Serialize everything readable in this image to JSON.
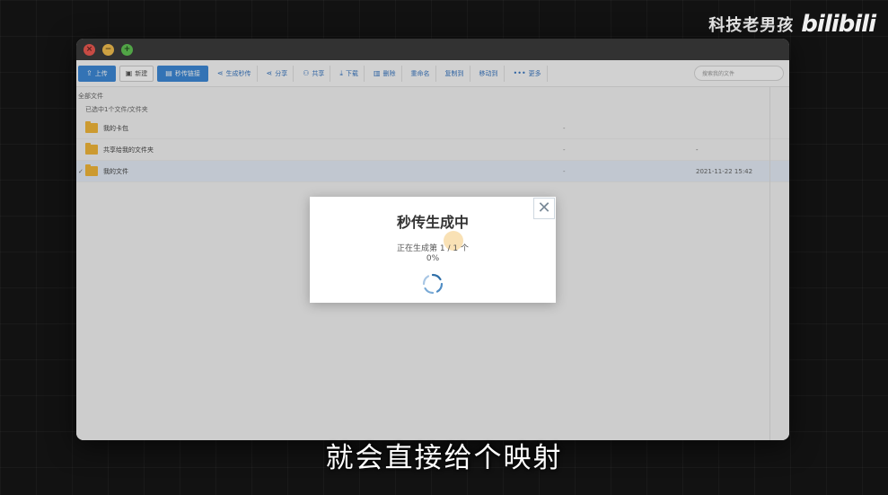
{
  "watermark": {
    "channel": "科技老男孩",
    "logo": "bilibili"
  },
  "window": {
    "controls": {
      "close": "×",
      "minimize": "−",
      "zoom": "+"
    }
  },
  "toolbar": {
    "upload": "上传",
    "new": "新建",
    "instant_link": "秒传链接",
    "generate_instant": "生成秒传",
    "share": "分享",
    "shared": "共享",
    "download": "下载",
    "delete": "删除",
    "rename": "重命名",
    "copy_to": "复制到",
    "move_to": "移动到",
    "more": "更多",
    "search_placeholder": "搜索我的文件"
  },
  "breadcrumb": "全部文件",
  "selection_info": "已选中1个文件/文件夹",
  "files": [
    {
      "name": "我的卡包",
      "size": "-",
      "date": "",
      "selected": false
    },
    {
      "name": "共享给我的文件夹",
      "size": "-",
      "date": "-",
      "selected": false
    },
    {
      "name": "我的文件",
      "size": "-",
      "date": "2021-11-22 15:42",
      "selected": true,
      "check": "✓"
    }
  ],
  "modal": {
    "title": "秒传生成中",
    "status": "正在生成第 1 / 1 个",
    "percent": "0%",
    "close_glyph": "✕"
  },
  "subtitle": "就会直接给个映射",
  "colors": {
    "accent": "#3d8ad8",
    "folder": "#f3b83a",
    "close": "#ee5a52",
    "minimize": "#f4bf4f",
    "zoom": "#61c454"
  }
}
